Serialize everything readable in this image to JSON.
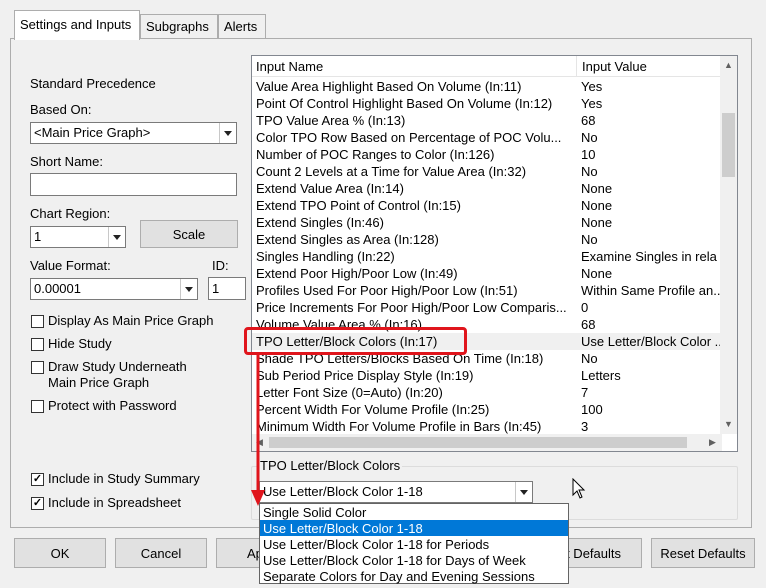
{
  "tabs": [
    {
      "label": "Settings and Inputs",
      "active": true
    },
    {
      "label": "Subgraphs",
      "active": false
    },
    {
      "label": "Alerts",
      "active": false
    }
  ],
  "left": {
    "standard_precedence": "Standard Precedence",
    "based_on_label": "Based On:",
    "based_on_value": "<Main Price Graph>",
    "short_name_label": "Short Name:",
    "short_name_value": "",
    "chart_region_label": "Chart Region:",
    "chart_region_value": "1",
    "scale_button": "Scale",
    "value_format_label": "Value Format:",
    "value_format_value": "0.00001",
    "id_label": "ID:",
    "id_value": "1",
    "checkboxes": [
      {
        "label": "Display As Main Price Graph",
        "checked": false
      },
      {
        "label": "Hide Study",
        "checked": false
      },
      {
        "label": "Draw Study Underneath",
        "label2": "Main Price Graph",
        "checked": false
      },
      {
        "label": "Protect with Password",
        "checked": false
      }
    ],
    "include_summary": {
      "label": "Include in Study Summary",
      "checked": true
    },
    "include_spreadsheet": {
      "label": "Include in Spreadsheet",
      "checked": true
    }
  },
  "grid": {
    "col_name": "Input Name",
    "col_value": "Input Value",
    "rows": [
      {
        "name": "Value Area Highlight Based On Volume  (In:11)",
        "value": "Yes"
      },
      {
        "name": "Point Of Control Highlight Based On Volume  (In:12)",
        "value": "Yes"
      },
      {
        "name": "TPO Value Area %  (In:13)",
        "value": "68"
      },
      {
        "name": "Color TPO Row Based on Percentage of POC Volu...",
        "value": "No"
      },
      {
        "name": "Number of POC Ranges to Color  (In:126)",
        "value": "10"
      },
      {
        "name": "Count 2 Levels at a Time for Value Area  (In:32)",
        "value": "No"
      },
      {
        "name": "Extend Value Area  (In:14)",
        "value": "None"
      },
      {
        "name": "Extend TPO Point of Control  (In:15)",
        "value": "None"
      },
      {
        "name": "Extend Singles  (In:46)",
        "value": "None"
      },
      {
        "name": "Extend Singles as Area  (In:128)",
        "value": "No"
      },
      {
        "name": "Singles Handling  (In:22)",
        "value": "Examine Singles in rela"
      },
      {
        "name": "Extend Poor High/Poor Low  (In:49)",
        "value": "None"
      },
      {
        "name": "Profiles Used For Poor High/Poor Low  (In:51)",
        "value": "Within Same Profile an..."
      },
      {
        "name": "Price Increments For Poor High/Poor Low Comparis...",
        "value": "0"
      },
      {
        "name": "Volume Value Area %  (In:16)",
        "value": "68"
      },
      {
        "name": "TPO Letter/Block Colors  (In:17)",
        "value": "Use Letter/Block Color ..."
      },
      {
        "name": "Shade TPO Letters/Blocks Based On Time  (In:18)",
        "value": "No"
      },
      {
        "name": "Sub Period Price Display Style  (In:19)",
        "value": "Letters"
      },
      {
        "name": "Letter Font Size (0=Auto)  (In:20)",
        "value": "7"
      },
      {
        "name": "Percent Width For Volume Profile  (In:25)",
        "value": "100"
      },
      {
        "name": "Minimum Width For Volume Profile in Bars  (In:45)",
        "value": "3"
      }
    ]
  },
  "selected_input": {
    "title": "TPO Letter/Block Colors",
    "value": "Use Letter/Block Color 1-18",
    "options": [
      "Single Solid Color",
      "Use Letter/Block Color 1-18",
      "Use Letter/Block Color 1-18 for Periods",
      "Use Letter/Block Color 1-18 for Days of Week",
      "Separate Colors for Day and Evening Sessions"
    ],
    "highlighted_index": 1
  },
  "buttons": {
    "ok": "OK",
    "cancel": "Cancel",
    "apply_partial": "Ap",
    "set_defaults_partial": "t Defaults",
    "reset_defaults": "Reset Defaults"
  },
  "colors": {
    "annotation_red": "#e0151c",
    "highlight_blue": "#0078d7"
  }
}
